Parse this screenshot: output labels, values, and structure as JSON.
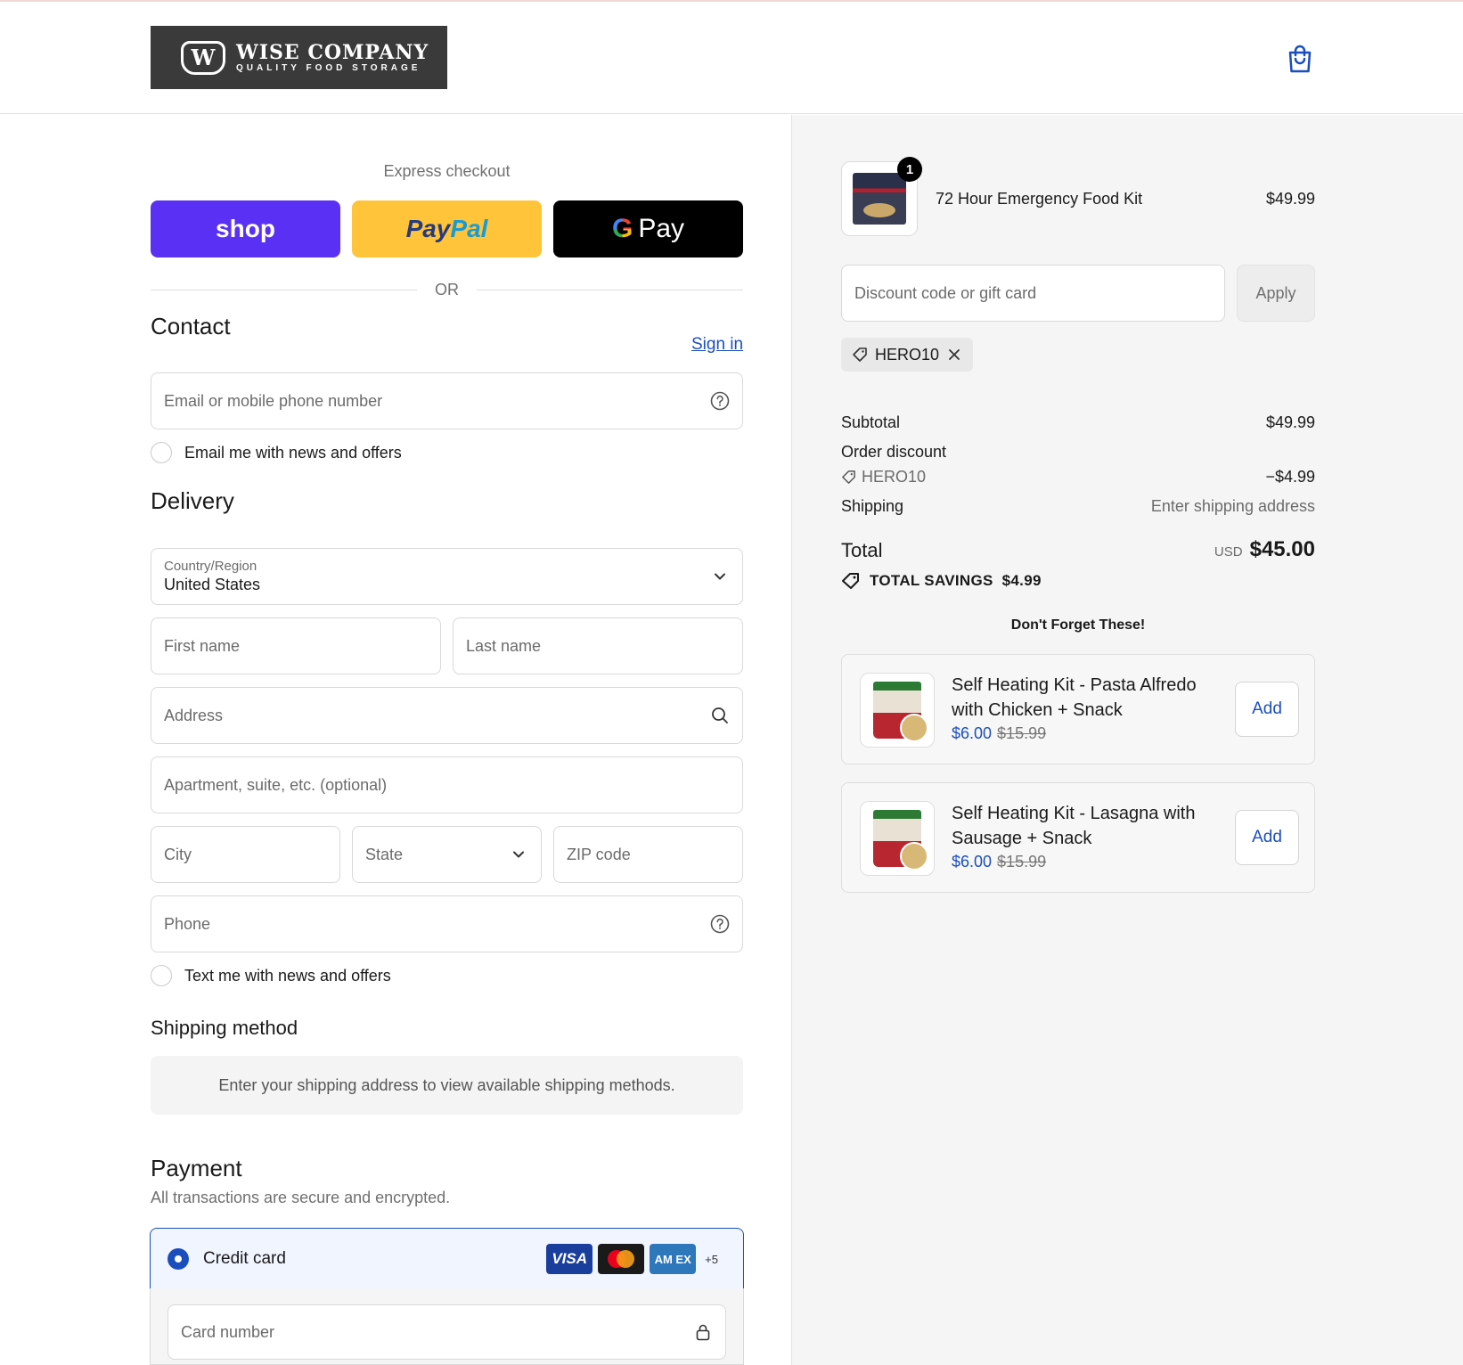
{
  "brand": {
    "name": "WISE COMPANY",
    "tagline": "QUALITY FOOD STORAGE",
    "badge": "W",
    "color": "#3a3a3a"
  },
  "header": {
    "cart_icon": "shopping-bag-icon"
  },
  "express": {
    "title": "Express checkout",
    "shop_label": "shop",
    "paypal_label_1": "Pay",
    "paypal_label_2": "Pal",
    "gpay_g": "G",
    "gpay_label": "Pay",
    "or": "OR"
  },
  "contact": {
    "title": "Contact",
    "sign_in": "Sign in",
    "email_placeholder": "Email or mobile phone number",
    "email_news": "Email me with news and offers"
  },
  "delivery": {
    "title": "Delivery",
    "country_label": "Country/Region",
    "country_value": "United States",
    "first_name": "First name",
    "last_name": "Last name",
    "address": "Address",
    "apartment": "Apartment, suite, etc. (optional)",
    "city": "City",
    "state": "State",
    "zip": "ZIP code",
    "phone": "Phone",
    "text_news": "Text me with news and offers"
  },
  "shipping_method": {
    "title": "Shipping method",
    "note": "Enter your shipping address to view available shipping methods."
  },
  "payment": {
    "title": "Payment",
    "subtitle": "All transactions are secure and encrypted.",
    "method": "Credit card",
    "cards": {
      "visa": "VISA",
      "amex": "AM EX",
      "more": "+5"
    },
    "card_number": "Card number"
  },
  "order": {
    "item": {
      "quantity": "1",
      "name": "72 Hour Emergency Food Kit",
      "price": "$49.99"
    },
    "discount_placeholder": "Discount code or gift card",
    "apply": "Apply",
    "applied_code": "HERO10",
    "subtotal_label": "Subtotal",
    "subtotal_value": "$49.99",
    "order_discount_label": "Order discount",
    "discount_code": "HERO10",
    "discount_value": "−$4.99",
    "shipping_label": "Shipping",
    "shipping_value": "Enter shipping address",
    "total_label": "Total",
    "currency": "USD",
    "total_value": "$45.00",
    "savings_label": "TOTAL SAVINGS",
    "savings_value": "$4.99"
  },
  "upsell": {
    "title": "Don't Forget These!",
    "items": [
      {
        "name": "Self Heating Kit - Pasta Alfredo with Chicken + Snack",
        "price": "$6.00",
        "compare": "$15.99",
        "add": "Add"
      },
      {
        "name": "Self Heating Kit - Lasagna with Sausage + Snack",
        "price": "$6.00",
        "compare": "$15.99",
        "add": "Add"
      }
    ]
  },
  "colors": {
    "accent": "#1b4ebd",
    "shop": "#5a31f4",
    "paypal": "#ffc439"
  }
}
